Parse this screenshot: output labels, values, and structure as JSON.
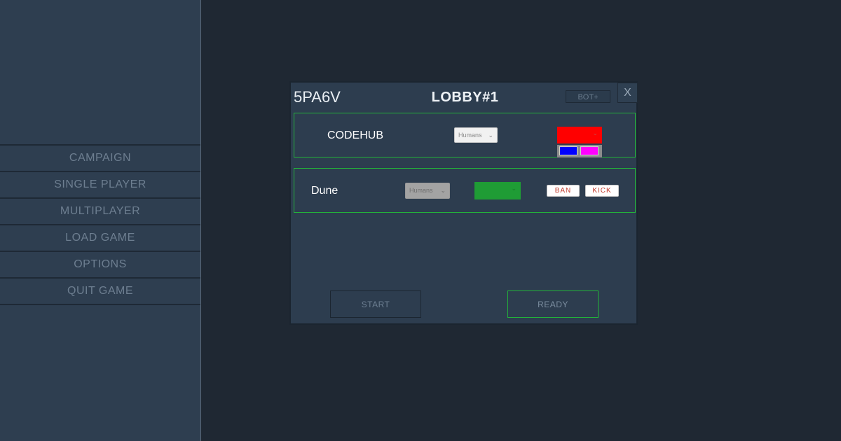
{
  "menu": {
    "items": [
      {
        "label": "CAMPAIGN"
      },
      {
        "label": "SINGLE PLAYER"
      },
      {
        "label": "MULTIPLAYER"
      },
      {
        "label": "LOAD GAME"
      },
      {
        "label": "OPTIONS"
      },
      {
        "label": "QUIT GAME"
      }
    ]
  },
  "lobby": {
    "code": "5PA6V",
    "title": "LOBBY#1",
    "bot_button": "BOT+",
    "close_button": "X",
    "players": [
      {
        "name": "CODEHUB",
        "race": "Humans",
        "race_enabled": true,
        "color": "#ff0000",
        "palette_open": true,
        "palette_options": [
          "#0000ff",
          "#ff00ff"
        ]
      },
      {
        "name": "Dune",
        "race": "Humans",
        "race_enabled": false,
        "color": "#1f9c35",
        "ban_label": "BAN",
        "kick_label": "KICK"
      }
    ],
    "start_button": "START",
    "ready_button": "READY"
  },
  "colors": {
    "background": "#1f2833",
    "sidebar": "#2e3e50",
    "panel": "#2d3d4f",
    "accent_green": "#23b23a"
  }
}
